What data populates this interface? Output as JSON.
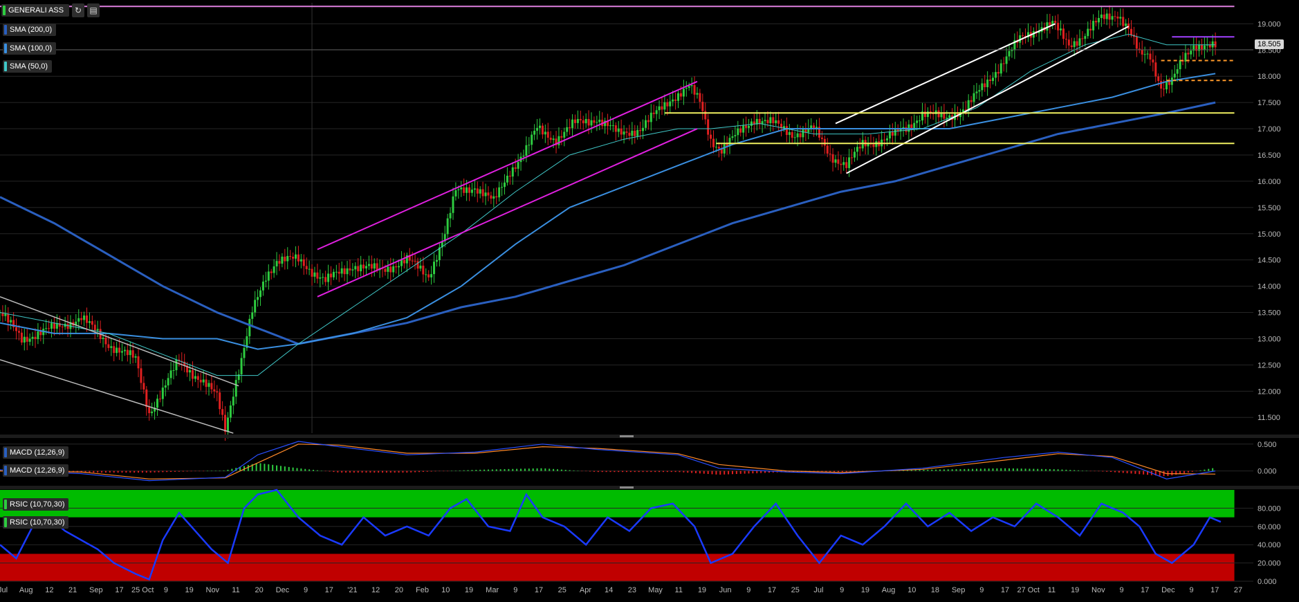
{
  "toolbar": {
    "symbol": "GENERALI ASS",
    "refresh_icon": "refresh-icon",
    "calendar_icon": "calendar-icon",
    "indicators": [
      {
        "label": "SMA (200,0)",
        "color": "#2a5fbf"
      },
      {
        "label": "SMA (100,0)",
        "color": "#3a8fe0"
      },
      {
        "label": "SMA (50,0)",
        "color": "#40c8c8"
      }
    ]
  },
  "last_price": "18.505",
  "panels": {
    "macd_labels": [
      "MACD (12,26,9)",
      "MACD (12,26,9)"
    ],
    "rsi_labels": [
      "RSIC (10,70,30)",
      "RSIC (10,70,30)"
    ]
  },
  "colors": {
    "up": "#2ecc40",
    "down": "#e02020",
    "channel_magenta": "#e020e0",
    "channel_white": "#ffffff",
    "support_yellow": "#f0f060",
    "resistance_orange": "#ff9a2a",
    "rsi_overbought": "#00bb00",
    "rsi_oversold": "#c00000",
    "rsi_line": "#1a3aff"
  },
  "chart_data": [
    {
      "type": "candlestick",
      "title": "GENERALI ASS",
      "ylim": [
        11.2,
        19.4
      ],
      "y_ticks": [
        "19.000",
        "18.500",
        "18.000",
        "17.500",
        "17.000",
        "16.500",
        "16.000",
        "15.500",
        "15.000",
        "14.500",
        "14.000",
        "13.500",
        "13.000",
        "12.500",
        "12.000",
        "11.500"
      ],
      "x_labels": [
        "Jul",
        "Aug",
        "12",
        "21",
        "Sep",
        "17",
        "25 Oct",
        "9",
        "19",
        "Nov",
        "11",
        "20",
        "Dec",
        "9",
        "17",
        "'21",
        "12",
        "20",
        "Feb",
        "10",
        "19",
        "Mar",
        "9",
        "17",
        "25",
        "Apr",
        "14",
        "23",
        "May",
        "11",
        "19",
        "Jun",
        "9",
        "17",
        "25",
        "Jul",
        "9",
        "19",
        "Aug",
        "10",
        "18",
        "Sep",
        "9",
        "17",
        "27 Oct",
        "11",
        "19",
        "Nov",
        "9",
        "17",
        "Dec",
        "9",
        "17",
        "27"
      ],
      "close_path": [
        [
          0,
          13.5
        ],
        [
          8,
          13.0
        ],
        [
          20,
          13.2
        ],
        [
          30,
          13.4
        ],
        [
          40,
          12.9
        ],
        [
          50,
          12.6
        ],
        [
          55,
          11.6
        ],
        [
          60,
          12.0
        ],
        [
          66,
          12.6
        ],
        [
          72,
          12.3
        ],
        [
          80,
          11.9
        ],
        [
          83,
          11.3
        ],
        [
          86,
          12.0
        ],
        [
          90,
          12.8
        ],
        [
          93,
          13.5
        ],
        [
          98,
          14.2
        ],
        [
          102,
          14.5
        ],
        [
          110,
          14.5
        ],
        [
          120,
          14.1
        ],
        [
          130,
          14.4
        ],
        [
          140,
          14.3
        ],
        [
          150,
          14.5
        ],
        [
          158,
          14.2
        ],
        [
          164,
          15.0
        ],
        [
          168,
          15.8
        ],
        [
          175,
          15.9
        ],
        [
          182,
          15.6
        ],
        [
          188,
          16.2
        ],
        [
          194,
          16.6
        ],
        [
          198,
          17.0
        ],
        [
          205,
          16.8
        ],
        [
          212,
          17.1
        ],
        [
          220,
          17.2
        ],
        [
          228,
          16.9
        ],
        [
          236,
          17.0
        ],
        [
          242,
          17.3
        ],
        [
          248,
          17.6
        ],
        [
          254,
          17.8
        ],
        [
          258,
          17.5
        ],
        [
          262,
          16.8
        ],
        [
          266,
          16.6
        ],
        [
          272,
          16.9
        ],
        [
          278,
          17.2
        ],
        [
          285,
          17.1
        ],
        [
          292,
          16.9
        ],
        [
          300,
          17.0
        ],
        [
          306,
          16.5
        ],
        [
          312,
          16.3
        ],
        [
          318,
          16.7
        ],
        [
          326,
          16.8
        ],
        [
          334,
          17.0
        ],
        [
          340,
          17.3
        ],
        [
          348,
          17.2
        ],
        [
          356,
          17.4
        ],
        [
          364,
          17.9
        ],
        [
          370,
          18.3
        ],
        [
          376,
          18.7
        ],
        [
          382,
          18.9
        ],
        [
          388,
          19.0
        ],
        [
          394,
          18.6
        ],
        [
          400,
          18.8
        ],
        [
          406,
          19.1
        ],
        [
          412,
          19.2
        ],
        [
          416,
          18.9
        ],
        [
          420,
          18.4
        ],
        [
          424,
          18.4
        ],
        [
          428,
          17.8
        ],
        [
          432,
          17.9
        ],
        [
          436,
          18.3
        ],
        [
          440,
          18.6
        ],
        [
          444,
          18.6
        ],
        [
          448,
          18.55
        ]
      ],
      "sma_50": [
        [
          0,
          13.5
        ],
        [
          20,
          13.3
        ],
        [
          40,
          13.1
        ],
        [
          60,
          12.7
        ],
        [
          80,
          12.3
        ],
        [
          95,
          12.3
        ],
        [
          110,
          12.9
        ],
        [
          130,
          13.6
        ],
        [
          150,
          14.3
        ],
        [
          170,
          15.0
        ],
        [
          190,
          15.8
        ],
        [
          210,
          16.5
        ],
        [
          230,
          16.8
        ],
        [
          250,
          17.0
        ],
        [
          262,
          17.0
        ],
        [
          280,
          17.1
        ],
        [
          300,
          16.9
        ],
        [
          320,
          16.9
        ],
        [
          340,
          17.0
        ],
        [
          360,
          17.4
        ],
        [
          380,
          18.1
        ],
        [
          400,
          18.6
        ],
        [
          416,
          18.8
        ],
        [
          430,
          18.6
        ],
        [
          448,
          18.6
        ]
      ],
      "sma_100": [
        [
          0,
          13.3
        ],
        [
          20,
          13.1
        ],
        [
          40,
          13.1
        ],
        [
          60,
          13.0
        ],
        [
          80,
          13.0
        ],
        [
          95,
          12.8
        ],
        [
          110,
          12.9
        ],
        [
          130,
          13.1
        ],
        [
          150,
          13.4
        ],
        [
          170,
          14.0
        ],
        [
          190,
          14.8
        ],
        [
          210,
          15.5
        ],
        [
          230,
          15.9
        ],
        [
          250,
          16.3
        ],
        [
          270,
          16.7
        ],
        [
          290,
          17.0
        ],
        [
          310,
          17.0
        ],
        [
          330,
          17.0
        ],
        [
          350,
          17.0
        ],
        [
          370,
          17.2
        ],
        [
          390,
          17.4
        ],
        [
          410,
          17.6
        ],
        [
          430,
          17.9
        ],
        [
          448,
          18.05
        ]
      ],
      "sma_200": [
        [
          0,
          15.7
        ],
        [
          20,
          15.2
        ],
        [
          40,
          14.6
        ],
        [
          60,
          14.0
        ],
        [
          80,
          13.5
        ],
        [
          95,
          13.2
        ],
        [
          110,
          12.9
        ],
        [
          130,
          13.1
        ],
        [
          150,
          13.3
        ],
        [
          170,
          13.6
        ],
        [
          190,
          13.8
        ],
        [
          210,
          14.1
        ],
        [
          230,
          14.4
        ],
        [
          250,
          14.8
        ],
        [
          270,
          15.2
        ],
        [
          290,
          15.5
        ],
        [
          310,
          15.8
        ],
        [
          330,
          16.0
        ],
        [
          350,
          16.3
        ],
        [
          370,
          16.6
        ],
        [
          390,
          16.9
        ],
        [
          410,
          17.1
        ],
        [
          430,
          17.3
        ],
        [
          448,
          17.5
        ]
      ],
      "trendlines": [
        {
          "name": "descending-channel-upper",
          "color": "#bbbbbb",
          "points": [
            [
              0,
              13.8
            ],
            [
              88,
              12.1
            ]
          ]
        },
        {
          "name": "descending-channel-lower",
          "color": "#bbbbbb",
          "points": [
            [
              0,
              12.6
            ],
            [
              86,
              11.2
            ]
          ]
        },
        {
          "name": "magenta-channel-upper",
          "color": "#e020e0",
          "points": [
            [
              117,
              14.7
            ],
            [
              257,
              17.9
            ]
          ]
        },
        {
          "name": "magenta-channel-lower",
          "color": "#e020e0",
          "points": [
            [
              117,
              13.8
            ],
            [
              257,
              17.0
            ]
          ]
        },
        {
          "name": "white-channel-upper",
          "color": "#ffffff",
          "points": [
            [
              308,
              17.1
            ],
            [
              389,
              19.0
            ]
          ]
        },
        {
          "name": "white-channel-lower",
          "color": "#ffffff",
          "points": [
            [
              312,
              16.15
            ],
            [
              416,
              18.95
            ]
          ]
        },
        {
          "name": "support-upper",
          "color": "#f0f060",
          "points": [
            [
              245,
              17.3
            ],
            [
              455,
              17.3
            ]
          ]
        },
        {
          "name": "support-lower",
          "color": "#f0f060",
          "points": [
            [
              264,
              16.72
            ],
            [
              455,
              16.72
            ]
          ]
        },
        {
          "name": "resistance-1",
          "color": "#ff9a2a",
          "dashed": true,
          "points": [
            [
              428,
              18.3
            ],
            [
              455,
              18.3
            ]
          ]
        },
        {
          "name": "resistance-2",
          "color": "#ff9a2a",
          "dashed": true,
          "points": [
            [
              430,
              17.92
            ],
            [
              455,
              17.92
            ]
          ]
        },
        {
          "name": "purple-level",
          "color": "#a040ff",
          "points": [
            [
              432,
              18.75
            ],
            [
              455,
              18.75
            ]
          ]
        },
        {
          "name": "top-level",
          "color": "#e080e0",
          "points": [
            [
              0,
              19.33
            ],
            [
              455,
              19.33
            ]
          ]
        }
      ]
    },
    {
      "type": "bar",
      "title": "MACD (12,26,9)",
      "ylim": [
        -0.25,
        0.6
      ],
      "y_ticks": [
        "0.500",
        "0.000"
      ],
      "macd_line": [
        [
          0,
          0.02
        ],
        [
          30,
          -0.05
        ],
        [
          55,
          -0.18
        ],
        [
          83,
          -0.12
        ],
        [
          95,
          0.3
        ],
        [
          110,
          0.55
        ],
        [
          125,
          0.45
        ],
        [
          150,
          0.3
        ],
        [
          175,
          0.35
        ],
        [
          200,
          0.5
        ],
        [
          220,
          0.4
        ],
        [
          250,
          0.3
        ],
        [
          265,
          0.05
        ],
        [
          290,
          -0.02
        ],
        [
          310,
          -0.05
        ],
        [
          340,
          0.05
        ],
        [
          370,
          0.25
        ],
        [
          390,
          0.35
        ],
        [
          410,
          0.25
        ],
        [
          430,
          -0.15
        ],
        [
          448,
          0.0
        ]
      ],
      "signal_line": [
        [
          0,
          0.0
        ],
        [
          30,
          -0.02
        ],
        [
          55,
          -0.15
        ],
        [
          83,
          -0.13
        ],
        [
          95,
          0.15
        ],
        [
          110,
          0.5
        ],
        [
          125,
          0.48
        ],
        [
          150,
          0.33
        ],
        [
          175,
          0.33
        ],
        [
          200,
          0.45
        ],
        [
          220,
          0.42
        ],
        [
          250,
          0.32
        ],
        [
          265,
          0.12
        ],
        [
          290,
          0.0
        ],
        [
          310,
          -0.03
        ],
        [
          340,
          0.03
        ],
        [
          370,
          0.2
        ],
        [
          390,
          0.32
        ],
        [
          410,
          0.27
        ],
        [
          430,
          -0.05
        ],
        [
          448,
          -0.06
        ]
      ]
    },
    {
      "type": "line",
      "title": "RSIC (10,70,30)",
      "ylim": [
        0,
        100
      ],
      "y_ticks": [
        "80.000",
        "60.000",
        "40.000",
        "20.000",
        "0.000"
      ],
      "overbought": 70,
      "oversold": 30,
      "rsi": [
        [
          0,
          40
        ],
        [
          6,
          25
        ],
        [
          12,
          60
        ],
        [
          18,
          70
        ],
        [
          24,
          55
        ],
        [
          30,
          45
        ],
        [
          36,
          35
        ],
        [
          42,
          20
        ],
        [
          50,
          8
        ],
        [
          55,
          2
        ],
        [
          60,
          45
        ],
        [
          66,
          75
        ],
        [
          72,
          55
        ],
        [
          78,
          35
        ],
        [
          84,
          20
        ],
        [
          90,
          80
        ],
        [
          95,
          95
        ],
        [
          102,
          100
        ],
        [
          110,
          70
        ],
        [
          118,
          50
        ],
        [
          126,
          40
        ],
        [
          134,
          70
        ],
        [
          142,
          50
        ],
        [
          150,
          60
        ],
        [
          158,
          50
        ],
        [
          166,
          80
        ],
        [
          172,
          90
        ],
        [
          180,
          60
        ],
        [
          188,
          55
        ],
        [
          194,
          95
        ],
        [
          200,
          70
        ],
        [
          208,
          60
        ],
        [
          216,
          40
        ],
        [
          224,
          70
        ],
        [
          232,
          55
        ],
        [
          240,
          80
        ],
        [
          248,
          85
        ],
        [
          256,
          60
        ],
        [
          262,
          20
        ],
        [
          270,
          30
        ],
        [
          278,
          60
        ],
        [
          286,
          85
        ],
        [
          294,
          50
        ],
        [
          302,
          20
        ],
        [
          310,
          50
        ],
        [
          318,
          40
        ],
        [
          326,
          60
        ],
        [
          334,
          85
        ],
        [
          342,
          60
        ],
        [
          350,
          75
        ],
        [
          358,
          55
        ],
        [
          366,
          70
        ],
        [
          374,
          60
        ],
        [
          382,
          85
        ],
        [
          390,
          70
        ],
        [
          398,
          50
        ],
        [
          406,
          85
        ],
        [
          414,
          75
        ],
        [
          420,
          60
        ],
        [
          426,
          30
        ],
        [
          432,
          20
        ],
        [
          440,
          40
        ],
        [
          446,
          70
        ],
        [
          450,
          65
        ]
      ]
    }
  ]
}
